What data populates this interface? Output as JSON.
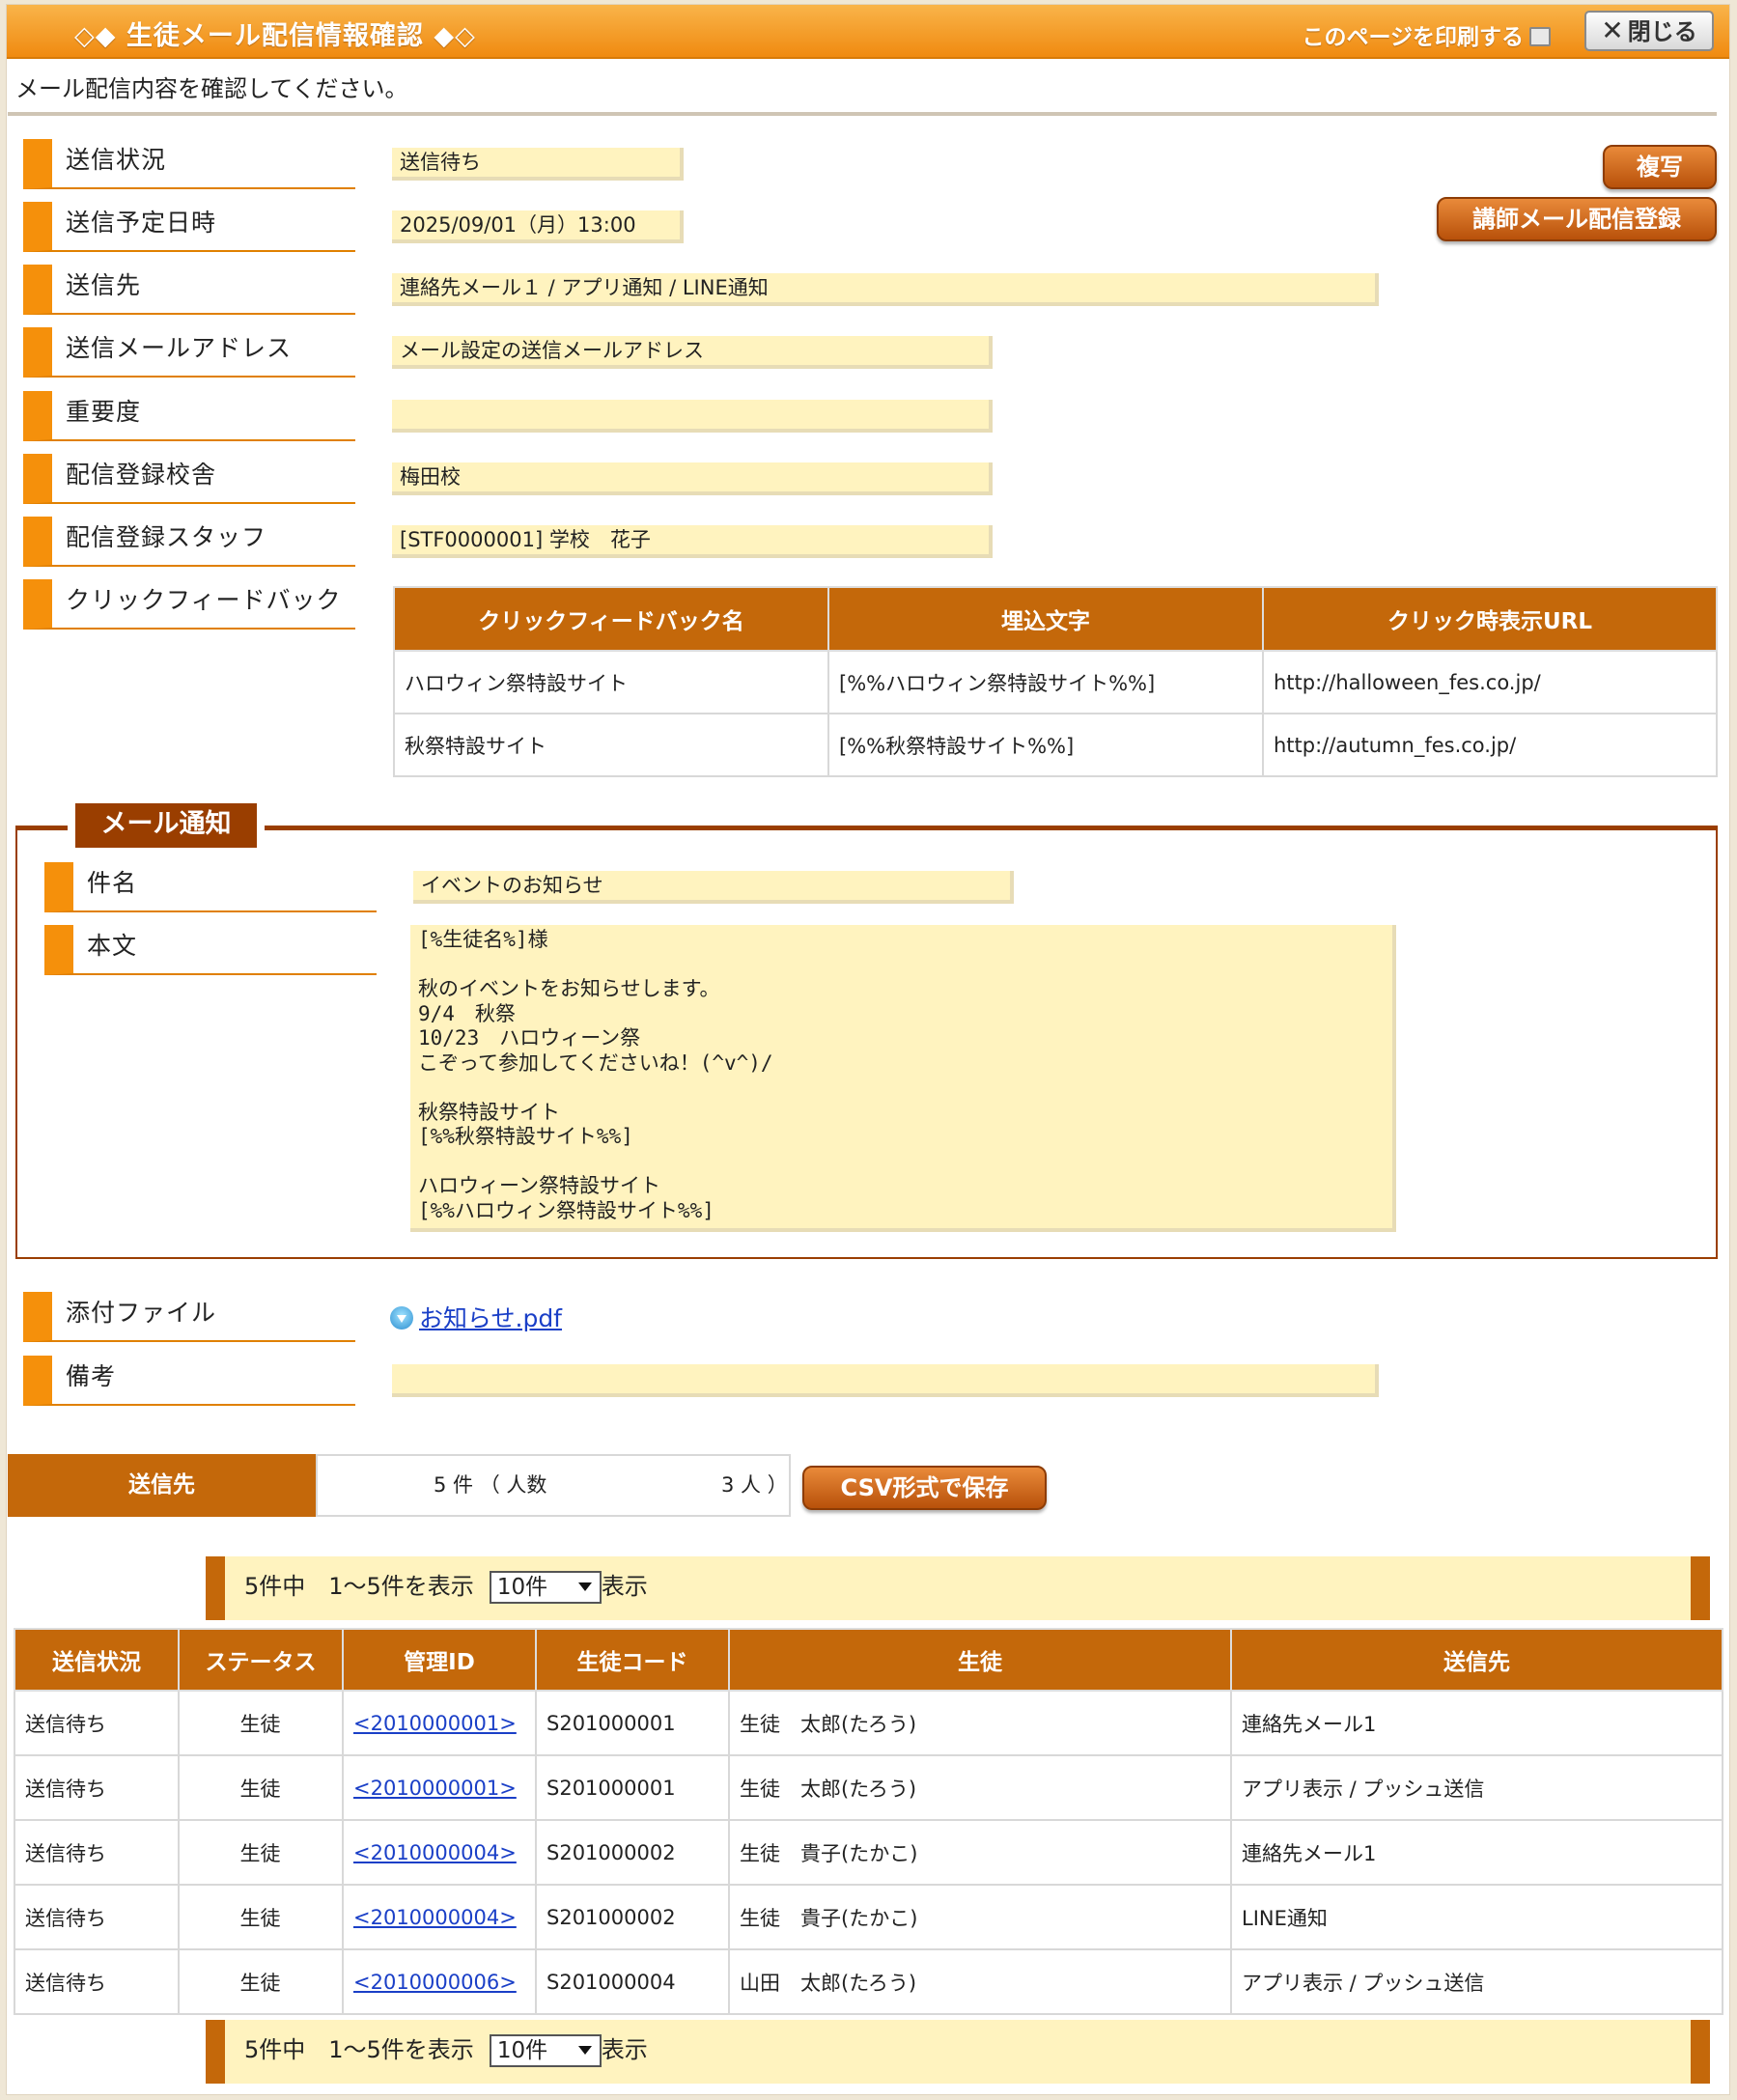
{
  "window": {
    "title": "◇◆ 生徒メール配信情報確認 ◆◇",
    "print_label": "このページを印刷する",
    "close_label": "閉じる"
  },
  "intro": "メール配信内容を確認してください。",
  "buttons": {
    "copy": "複写",
    "teacher_register": "講師メール配信登録",
    "csv": "CSV形式で保存"
  },
  "fields": {
    "send_status": {
      "label": "送信状況",
      "value": "送信待ち"
    },
    "scheduled": {
      "label": "送信予定日時",
      "value": "2025/09/01（月）13:00"
    },
    "destination": {
      "label": "送信先",
      "value": "連絡先メール１ / アプリ通知 / LINE通知"
    },
    "sender_address": {
      "label": "送信メールアドレス",
      "value": "メール設定の送信メールアドレス"
    },
    "importance": {
      "label": "重要度",
      "value": ""
    },
    "campus": {
      "label": "配信登録校舎",
      "value": "梅田校"
    },
    "staff": {
      "label": "配信登録スタッフ",
      "value": "[STF0000001] 学校　花子"
    },
    "click_feedback": {
      "label": "クリックフィードバック"
    }
  },
  "feedback_table": {
    "headers": [
      "クリックフィードバック名",
      "埋込文字",
      "クリック時表示URL"
    ],
    "rows": [
      [
        "ハロウィン祭特設サイト",
        "[%%ハロウィン祭特設サイト%%]",
        "http://halloween_fes.co.jp/"
      ],
      [
        "秋祭特設サイト",
        "[%%秋祭特設サイト%%]",
        "http://autumn_fes.co.jp/"
      ]
    ]
  },
  "mail": {
    "legend": "メール通知",
    "subject_label": "件名",
    "subject_value": "イベントのお知らせ",
    "body_label": "本文",
    "body_text": "[%生徒名%]様\n\n秋のイベントをお知らせします。\n9/4　秋祭\n10/23　ハロウィーン祭\nこぞって参加してくださいね！(^v^)/\n\n秋祭特設サイト\n[%%秋祭特設サイト%%]\n\nハロウィーン祭特設サイト\n[%%ハロウィン祭特設サイト%%]"
  },
  "attachment": {
    "label": "添付ファイル",
    "file": "お知らせ.pdf"
  },
  "remarks": {
    "label": "備考",
    "value": ""
  },
  "recipients": {
    "header": "送信先",
    "count_text": "5 件 （ 人数",
    "people_text": "3 人 ）"
  },
  "pager": {
    "summary": "5件中　1～5件を表示",
    "select_value": "10件",
    "suffix": "表示"
  },
  "list_table": {
    "headers": [
      "送信状況",
      "ステータス",
      "管理ID",
      "生徒コード",
      "生徒",
      "送信先"
    ],
    "rows": [
      [
        "送信待ち",
        "生徒",
        "<2010000001>",
        "S201000001",
        "生徒　太郎(たろう)",
        "連絡先メール1"
      ],
      [
        "送信待ち",
        "生徒",
        "<2010000001>",
        "S201000001",
        "生徒　太郎(たろう)",
        "アプリ表示 / プッシュ送信"
      ],
      [
        "送信待ち",
        "生徒",
        "<2010000004>",
        "S201000002",
        "生徒　貴子(たかこ)",
        "連絡先メール1"
      ],
      [
        "送信待ち",
        "生徒",
        "<2010000004>",
        "S201000002",
        "生徒　貴子(たかこ)",
        "LINE通知"
      ],
      [
        "送信待ち",
        "生徒",
        "<2010000006>",
        "S201000004",
        "山田　太郎(たろう)",
        "アプリ表示 / プッシュ送信"
      ]
    ]
  }
}
